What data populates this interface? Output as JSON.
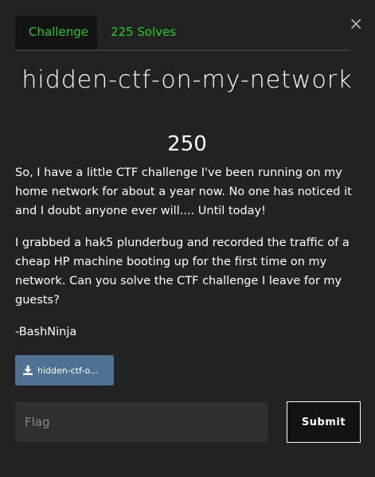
{
  "modal": {
    "close_glyph": "×"
  },
  "tabs": [
    {
      "label": "Challenge",
      "active": true
    },
    {
      "label": "225 Solves",
      "active": false
    }
  ],
  "challenge": {
    "title": "hidden-ctf-on-my-network",
    "points": "250",
    "description": [
      "So, I have a little CTF challenge I've been running on my home network for about a year now. No one has noticed it and I doubt anyone ever will.... Until today!",
      "I grabbed a hak5 plunderbug and recorded the traffic of a cheap HP machine booting up for the first time on my network. Can you solve the CTF challenge I leave for my guests?",
      "-BashNinja"
    ],
    "file_label": "hidden-ctf-o..."
  },
  "form": {
    "flag_placeholder": "Flag",
    "flag_value": "",
    "submit_label": "Submit"
  },
  "colors": {
    "background": "#222222",
    "tab_text": "#2ac72a",
    "file_button": "#4f7194"
  },
  "icons": {
    "close": "close-icon",
    "download": "download-icon"
  }
}
